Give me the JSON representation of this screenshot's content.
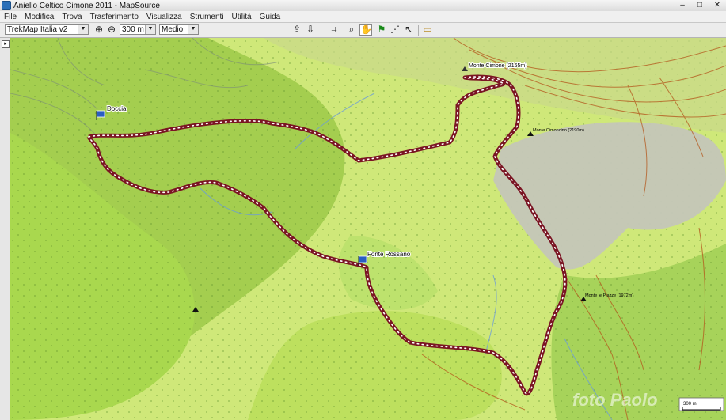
{
  "window": {
    "title": "Aniello Celtico Cimone 2011 - MapSource",
    "minimize": "–",
    "maximize": "□",
    "close": "✕"
  },
  "menu": [
    "File",
    "Modifica",
    "Trova",
    "Trasferimento",
    "Visualizza",
    "Strumenti",
    "Utilità",
    "Guida"
  ],
  "toolbar": {
    "map_product": "TrekMap Italia v2",
    "zoom_scale": "300 m",
    "detail": "Medio",
    "icons": [
      "zoom-in-icon",
      "zoom-out-icon",
      "send-to-device-icon",
      "receive-from-device-icon",
      "select-icon",
      "zoom-tool-icon",
      "hand-icon",
      "waypoint-flag-icon",
      "route-tool-icon",
      "track-pointer-icon",
      "measure-icon"
    ]
  },
  "map": {
    "waypoints": {
      "doccia": "Doccia",
      "fonte_rossano": "Fonte Rossano",
      "monte_cimone": "Monte Cimone (2165m)"
    },
    "summits": {
      "cimoncino": "Monte Cimoncino (2190m)",
      "piazze": "Monte le Piazze (1972m)"
    },
    "scale_label": "300 m",
    "watermark": "foto Paolo",
    "colors": {
      "track": "#7a1523",
      "track_dots": "#ffffff",
      "contour": "#b04a10",
      "light_green": "#c7e86a",
      "dark_green": "#8cbf3a",
      "rock_grey": "#c5c8b8"
    }
  }
}
